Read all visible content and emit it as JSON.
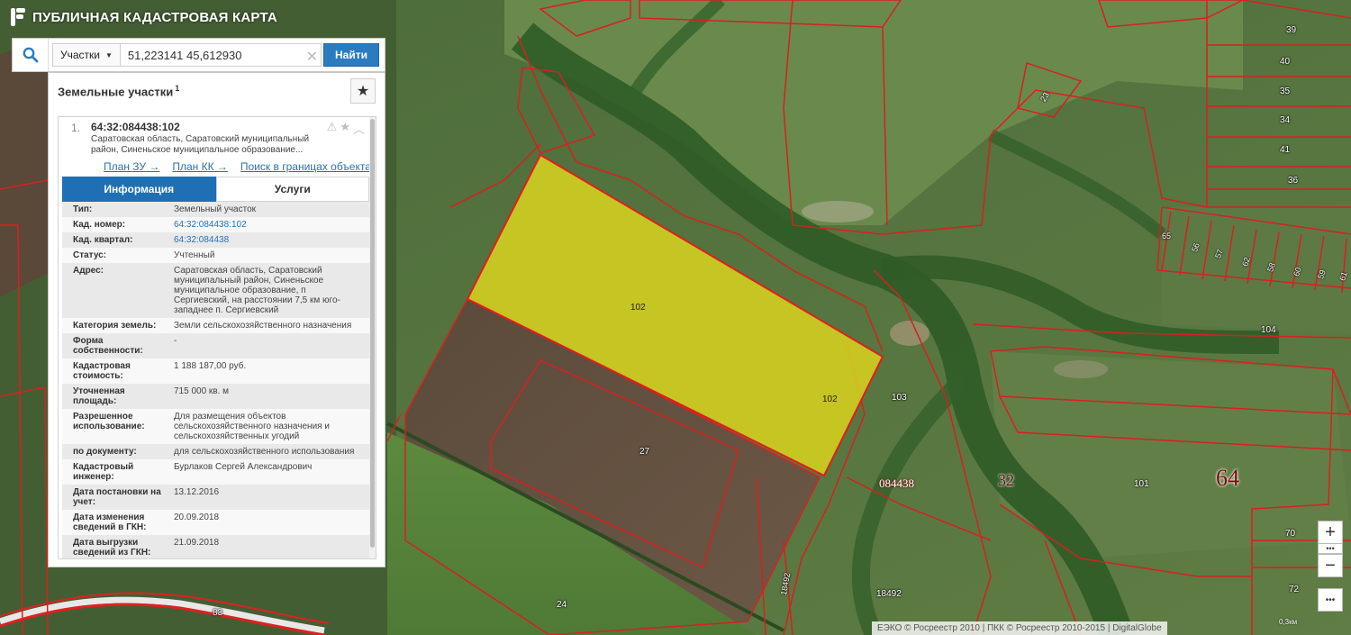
{
  "app": {
    "title": "ПУБЛИЧНАЯ КАДАСТРОВАЯ КАРТА"
  },
  "search": {
    "type_label": "Участки",
    "query": "51,223141 45,612930",
    "find_label": "Найти"
  },
  "panel": {
    "title": "Земельные участки",
    "count": "1"
  },
  "result": {
    "index": "1.",
    "cad_number": "64:32:084438:102",
    "address_short": "Саратовская область, Саратовский муниципальный район, Синеньское муниципальное образование...",
    "links": [
      "План ЗУ →",
      "План КК →",
      "Поиск в границах объекта →"
    ],
    "tabs": [
      "Информация",
      "Услуги"
    ],
    "info": [
      {
        "k": "Тип:",
        "v": "Земельный участок"
      },
      {
        "k": "Кад. номер:",
        "v": "64:32:084438:102",
        "link": true
      },
      {
        "k": "Кад. квартал:",
        "v": "64:32:084438",
        "link": true
      },
      {
        "k": "Статус:",
        "v": "Учтенный"
      },
      {
        "k": "Адрес:",
        "v": "Саратовская область, Саратовский муниципальный район, Синеньское муниципальное образование, п Сергиевский, на расстоянии 7,5 км юго-западнее п. Сергиевский"
      },
      {
        "k": "Категория земель:",
        "v": "Земли сельскохозяйственного назначения"
      },
      {
        "k": "Форма собственности:",
        "v": "-"
      },
      {
        "k": "Кадастровая стоимость:",
        "v": "1 188 187,00 руб."
      },
      {
        "k": "Уточненная площадь:",
        "v": "715 000 кв. м"
      },
      {
        "k": "Разрешенное использование:",
        "v": "Для размещения объектов сельскохозяйственного назначения и сельскохозяйственных угодий"
      },
      {
        "k": "по документу:",
        "v": "для сельскохозяйственного использования"
      },
      {
        "k": "Кадастровый инженер:",
        "v": "Бурлаков Сергей Александрович"
      },
      {
        "k": "Дата постановки на учет:",
        "v": "13.12.2016"
      },
      {
        "k": "Дата изменения сведений в ГКН:",
        "v": "20.09.2018"
      },
      {
        "k": "Дата выгрузки сведений из ГКН:",
        "v": "21.09.2018"
      }
    ]
  },
  "map": {
    "labels": {
      "parcel_main": "102",
      "parcel_main_2": "102",
      "l27": "27",
      "l24": "24",
      "l83": "83",
      "l103": "103",
      "l104": "104",
      "l101": "101",
      "l70": "70",
      "l72": "72",
      "l18492": "18492",
      "l18492r": "18492",
      "quarter": "084438",
      "district": "32",
      "region": "64",
      "l39": "39",
      "l40": "40",
      "l35": "35",
      "l34": "34",
      "l41": "41",
      "l36": "36",
      "l65": "65",
      "l56": "56",
      "l57": "57",
      "l62": "62",
      "l58": "58",
      "l60": "60",
      "l59": "59",
      "l61": "61",
      "l23": "23"
    },
    "attribution": "ЕЭКО © Росреестр 2010 | ПКК © Росреестр 2010-2015 | DigitalGlobe",
    "scale": "0,3км"
  },
  "colors": {
    "accent": "#1f6fb4",
    "parcel_fill": "#d9d41f",
    "boundary": "#d82020"
  },
  "icons": [
    "logo-icon",
    "search-icon",
    "chevron-down-icon",
    "clear-icon",
    "star-icon",
    "warning-icon",
    "chevron-up-icon",
    "plus-icon",
    "minus-icon",
    "more-icon"
  ]
}
